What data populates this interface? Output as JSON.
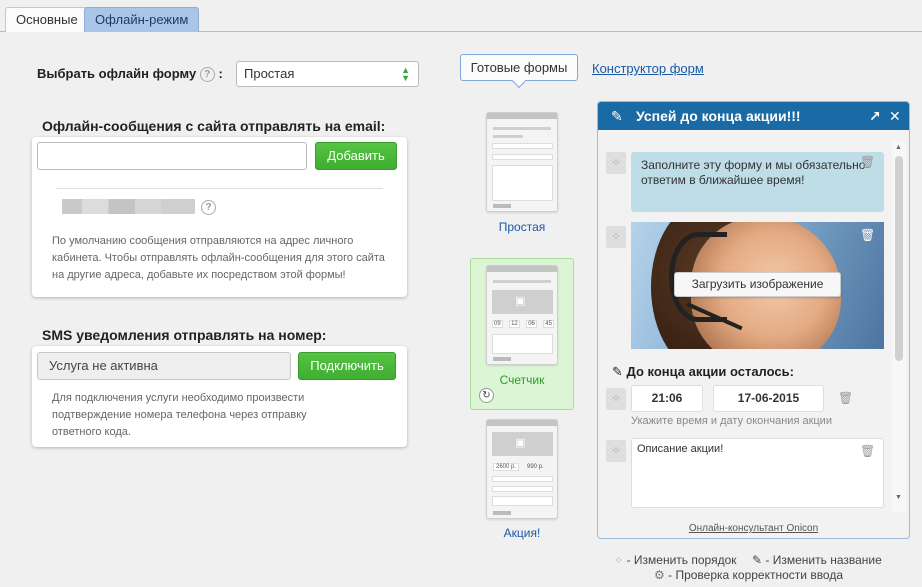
{
  "tabs": [
    {
      "label": "Основные",
      "active": false
    },
    {
      "label": "Офлайн-режим",
      "active": true
    }
  ],
  "select_form": {
    "label": "Выбрать офлайн форму",
    "help": "?",
    "colon": ":",
    "value": "Простая"
  },
  "email_section": {
    "title": "Офлайн-сообщения с сайта отправлять на email:",
    "input_value": "",
    "add_button": "Добавить",
    "help": "?",
    "description": "По умолчанию сообщения отправляются на адрес личного кабинета. Чтобы отправлять офлайн-сообщения для этого сайта на другие адреса, добавьте их посредством этой формы!"
  },
  "sms_section": {
    "title": "SMS уведомления отправлять на номер:",
    "field_value": "Услуга не активна",
    "connect_button": "Подключить",
    "description": "Для подключения услуги необходимо произвести подтверждение номера телефона через отправку ответного кода."
  },
  "forms_nav": {
    "ready_label": "Готовые формы",
    "constructor_label": "Конструктор форм"
  },
  "thumbnails": [
    {
      "label": "Простая",
      "selected": false
    },
    {
      "label": "Счетчик",
      "selected": true,
      "digits": [
        "09",
        "12",
        "06",
        "45"
      ]
    },
    {
      "label": "Акция!",
      "selected": false,
      "old_price": "2600 р.",
      "new_price": "990 р."
    }
  ],
  "widget": {
    "title": "Успей до конца акции!!!",
    "intro": "Заполните эту форму и мы обязательно ответим в ближайшее время!",
    "upload_label": "Загрузить изображение",
    "countdown_title": "До конца акции осталось:",
    "time": "21:06",
    "date": "17-06-2015",
    "hint": "Укажите время и дату окончания акции",
    "description_value": "Описание акции!",
    "footer": "Онлайн-консультант Onicon"
  },
  "legend": {
    "reorder": "- Изменить порядок",
    "rename": "- Изменить название",
    "validate": "- Проверка корректности ввода"
  },
  "colors": {
    "accent": "#1a6aa5",
    "green_button": "#44b336",
    "tab_active": "#a9c5e8",
    "selected_thumb_bg": "#dcf5d4",
    "link": "#1a5aa5"
  },
  "icons": [
    "help-icon",
    "select-arrows-icon",
    "pencil-icon",
    "expand-icon",
    "close-icon",
    "drag-handle-icon",
    "trash-icon",
    "refresh-icon",
    "gear-icon",
    "image-icon"
  ]
}
